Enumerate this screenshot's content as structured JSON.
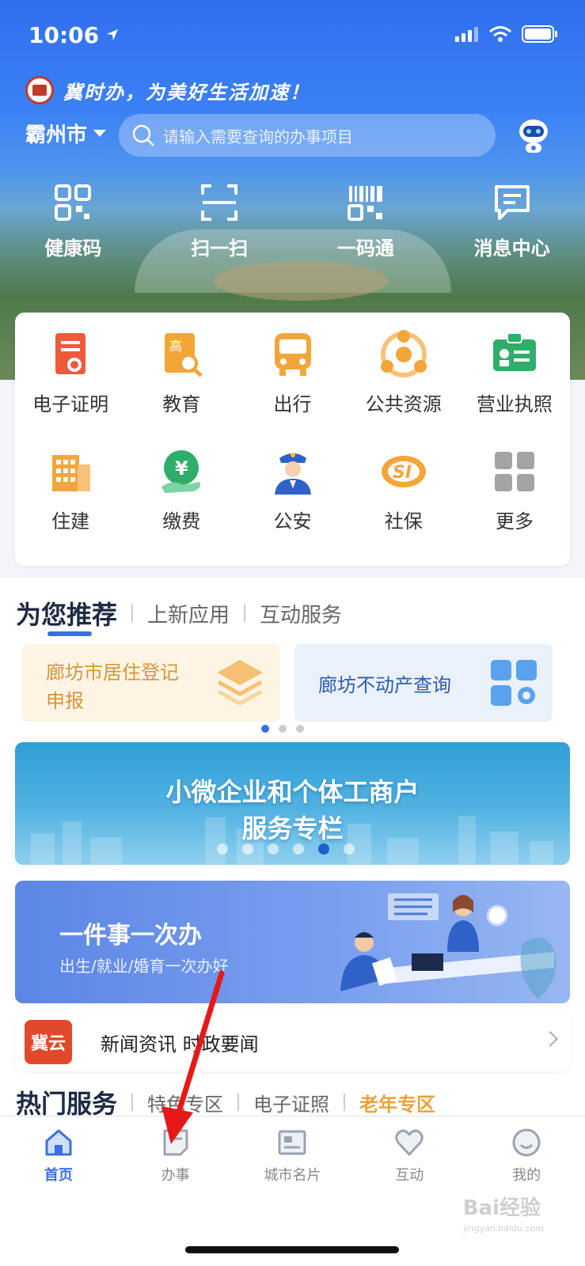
{
  "status_bar": {
    "time": "10:06"
  },
  "header": {
    "slogan": "冀时办，为美好生活加速！",
    "city": "霸州市",
    "search_placeholder": "请输入需要查询的办事项目"
  },
  "quick_actions": [
    {
      "label": "健康码",
      "icon": "health-code-icon"
    },
    {
      "label": "扫一扫",
      "icon": "scan-icon"
    },
    {
      "label": "一码通",
      "icon": "barcode-icon"
    },
    {
      "label": "消息中心",
      "icon": "message-icon"
    }
  ],
  "services": [
    {
      "label": "电子证明",
      "icon": "certificate-icon",
      "color": "#ef5a3a"
    },
    {
      "label": "教育",
      "icon": "education-icon",
      "color": "#f2a63a"
    },
    {
      "label": "出行",
      "icon": "bus-icon",
      "color": "#f2a63a"
    },
    {
      "label": "公共资源",
      "icon": "public-resource-icon",
      "color": "#f2a63a"
    },
    {
      "label": "营业执照",
      "icon": "license-icon",
      "color": "#2fae6a"
    },
    {
      "label": "住建",
      "icon": "building-icon",
      "color": "#f2a63a"
    },
    {
      "label": "缴费",
      "icon": "payment-icon",
      "color": "#2fae6a"
    },
    {
      "label": "公安",
      "icon": "police-icon",
      "color": "#2f62c8"
    },
    {
      "label": "社保",
      "icon": "social-security-icon",
      "color": "#f2a63a"
    },
    {
      "label": "更多",
      "icon": "more-grid-icon",
      "color": "#9a9a9a"
    }
  ],
  "recommend": {
    "tabs": [
      "为您推荐",
      "上新应用",
      "互动服务"
    ],
    "cards": [
      {
        "line1": "廊坊市居住登记",
        "line2": "申报"
      },
      {
        "line1": "廊坊不动产查询"
      }
    ]
  },
  "banner_small_business": {
    "line1": "小微企业和个体工商户",
    "line2": "服务专栏"
  },
  "banner_one_thing": {
    "title": "一件事一次办",
    "subtitle": "出生/就业/婚育一次办好"
  },
  "news": {
    "logo": "冀云",
    "label": "新闻资讯 时政要闻"
  },
  "hot_services": {
    "title": "热门服务",
    "tabs": [
      "特色专区",
      "电子证照",
      "老年专区"
    ]
  },
  "tabbar": [
    {
      "label": "首页",
      "icon": "home-icon",
      "active": true
    },
    {
      "label": "办事",
      "icon": "document-icon"
    },
    {
      "label": "城市名片",
      "icon": "city-card-icon"
    },
    {
      "label": "互动",
      "icon": "heart-icon"
    },
    {
      "label": "我的",
      "icon": "profile-smile-icon"
    }
  ],
  "watermark": {
    "brand": "Bai经验",
    "url": "jingyan.baidu.com"
  },
  "colors": {
    "brand_blue": "#2f6ff0",
    "active_tab": "#3b6fe0",
    "accent_orange": "#e8a33a"
  }
}
